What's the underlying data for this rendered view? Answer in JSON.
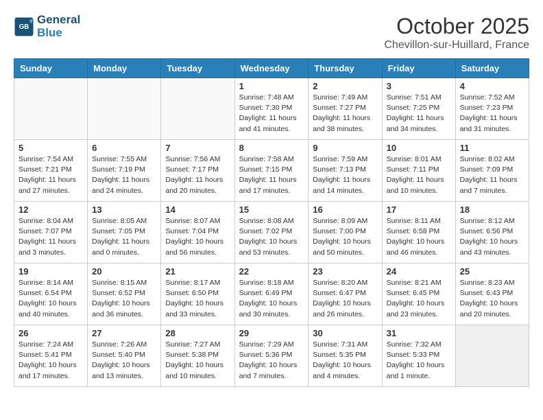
{
  "header": {
    "logo_line1": "General",
    "logo_line2": "Blue",
    "month": "October 2025",
    "location": "Chevillon-sur-Huillard, France"
  },
  "weekdays": [
    "Sunday",
    "Monday",
    "Tuesday",
    "Wednesday",
    "Thursday",
    "Friday",
    "Saturday"
  ],
  "weeks": [
    [
      {
        "day": "",
        "info": ""
      },
      {
        "day": "",
        "info": ""
      },
      {
        "day": "",
        "info": ""
      },
      {
        "day": "1",
        "info": "Sunrise: 7:48 AM\nSunset: 7:30 PM\nDaylight: 11 hours\nand 41 minutes."
      },
      {
        "day": "2",
        "info": "Sunrise: 7:49 AM\nSunset: 7:27 PM\nDaylight: 11 hours\nand 38 minutes."
      },
      {
        "day": "3",
        "info": "Sunrise: 7:51 AM\nSunset: 7:25 PM\nDaylight: 11 hours\nand 34 minutes."
      },
      {
        "day": "4",
        "info": "Sunrise: 7:52 AM\nSunset: 7:23 PM\nDaylight: 11 hours\nand 31 minutes."
      }
    ],
    [
      {
        "day": "5",
        "info": "Sunrise: 7:54 AM\nSunset: 7:21 PM\nDaylight: 11 hours\nand 27 minutes."
      },
      {
        "day": "6",
        "info": "Sunrise: 7:55 AM\nSunset: 7:19 PM\nDaylight: 11 hours\nand 24 minutes."
      },
      {
        "day": "7",
        "info": "Sunrise: 7:56 AM\nSunset: 7:17 PM\nDaylight: 11 hours\nand 20 minutes."
      },
      {
        "day": "8",
        "info": "Sunrise: 7:58 AM\nSunset: 7:15 PM\nDaylight: 11 hours\nand 17 minutes."
      },
      {
        "day": "9",
        "info": "Sunrise: 7:59 AM\nSunset: 7:13 PM\nDaylight: 11 hours\nand 14 minutes."
      },
      {
        "day": "10",
        "info": "Sunrise: 8:01 AM\nSunset: 7:11 PM\nDaylight: 11 hours\nand 10 minutes."
      },
      {
        "day": "11",
        "info": "Sunrise: 8:02 AM\nSunset: 7:09 PM\nDaylight: 11 hours\nand 7 minutes."
      }
    ],
    [
      {
        "day": "12",
        "info": "Sunrise: 8:04 AM\nSunset: 7:07 PM\nDaylight: 11 hours\nand 3 minutes."
      },
      {
        "day": "13",
        "info": "Sunrise: 8:05 AM\nSunset: 7:05 PM\nDaylight: 11 hours\nand 0 minutes."
      },
      {
        "day": "14",
        "info": "Sunrise: 8:07 AM\nSunset: 7:04 PM\nDaylight: 10 hours\nand 56 minutes."
      },
      {
        "day": "15",
        "info": "Sunrise: 8:08 AM\nSunset: 7:02 PM\nDaylight: 10 hours\nand 53 minutes."
      },
      {
        "day": "16",
        "info": "Sunrise: 8:09 AM\nSunset: 7:00 PM\nDaylight: 10 hours\nand 50 minutes."
      },
      {
        "day": "17",
        "info": "Sunrise: 8:11 AM\nSunset: 6:58 PM\nDaylight: 10 hours\nand 46 minutes."
      },
      {
        "day": "18",
        "info": "Sunrise: 8:12 AM\nSunset: 6:56 PM\nDaylight: 10 hours\nand 43 minutes."
      }
    ],
    [
      {
        "day": "19",
        "info": "Sunrise: 8:14 AM\nSunset: 6:54 PM\nDaylight: 10 hours\nand 40 minutes."
      },
      {
        "day": "20",
        "info": "Sunrise: 8:15 AM\nSunset: 6:52 PM\nDaylight: 10 hours\nand 36 minutes."
      },
      {
        "day": "21",
        "info": "Sunrise: 8:17 AM\nSunset: 6:50 PM\nDaylight: 10 hours\nand 33 minutes."
      },
      {
        "day": "22",
        "info": "Sunrise: 8:18 AM\nSunset: 6:49 PM\nDaylight: 10 hours\nand 30 minutes."
      },
      {
        "day": "23",
        "info": "Sunrise: 8:20 AM\nSunset: 6:47 PM\nDaylight: 10 hours\nand 26 minutes."
      },
      {
        "day": "24",
        "info": "Sunrise: 8:21 AM\nSunset: 6:45 PM\nDaylight: 10 hours\nand 23 minutes."
      },
      {
        "day": "25",
        "info": "Sunrise: 8:23 AM\nSunset: 6:43 PM\nDaylight: 10 hours\nand 20 minutes."
      }
    ],
    [
      {
        "day": "26",
        "info": "Sunrise: 7:24 AM\nSunset: 5:41 PM\nDaylight: 10 hours\nand 17 minutes."
      },
      {
        "day": "27",
        "info": "Sunrise: 7:26 AM\nSunset: 5:40 PM\nDaylight: 10 hours\nand 13 minutes."
      },
      {
        "day": "28",
        "info": "Sunrise: 7:27 AM\nSunset: 5:38 PM\nDaylight: 10 hours\nand 10 minutes."
      },
      {
        "day": "29",
        "info": "Sunrise: 7:29 AM\nSunset: 5:36 PM\nDaylight: 10 hours\nand 7 minutes."
      },
      {
        "day": "30",
        "info": "Sunrise: 7:31 AM\nSunset: 5:35 PM\nDaylight: 10 hours\nand 4 minutes."
      },
      {
        "day": "31",
        "info": "Sunrise: 7:32 AM\nSunset: 5:33 PM\nDaylight: 10 hours\nand 1 minute."
      },
      {
        "day": "",
        "info": ""
      }
    ]
  ]
}
